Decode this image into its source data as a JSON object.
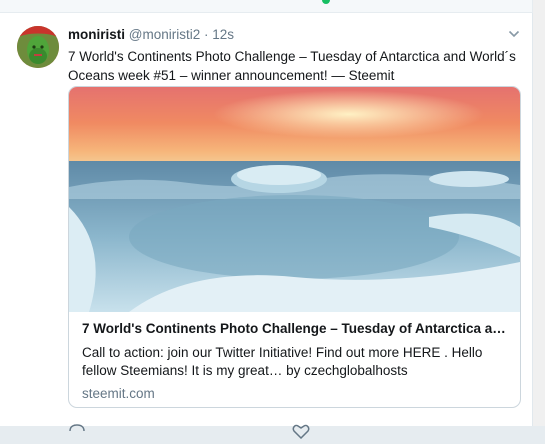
{
  "tweet": {
    "display_name": "moniristi",
    "handle": "@moniristi2",
    "separator": "·",
    "time": "12s",
    "text": "7 World's Continents Photo Challenge – Tuesday of Antarctica and World´s Oceans week #51 – winner announcement! — Steemit"
  },
  "card": {
    "title": "7 World's Continents Photo Challenge – Tuesday of Antarctica an...",
    "description": "Call to action: join our Twitter Initiative! Find out more HERE . Hello fellow Steemians! It is my great… by czechglobalhosts",
    "domain": "steemit.com"
  },
  "icons": {
    "caret": "chevron-down-icon",
    "avatar": "user-avatar"
  },
  "colors": {
    "name": "#14171a",
    "secondary": "#657786",
    "background": "#e6ecf0"
  }
}
